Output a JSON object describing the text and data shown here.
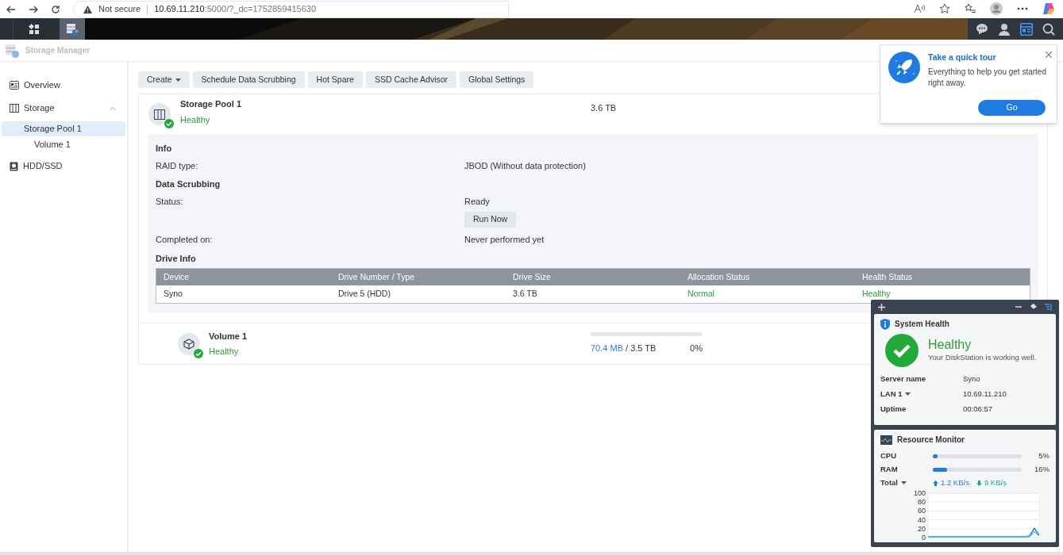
{
  "browser": {
    "warning": "Not secure",
    "url_host": "10.69.11.210",
    "url_path": ":5000/?_dc=1752859415630"
  },
  "app": {
    "title": "Storage Manager"
  },
  "sidebar": {
    "items": [
      {
        "label": "Overview",
        "selected": false
      },
      {
        "label": "Storage",
        "selected": false,
        "expanded": true,
        "children": [
          {
            "label": "Storage Pool 1",
            "selected": true,
            "children": [
              {
                "label": "Volume 1",
                "selected": false
              }
            ]
          }
        ]
      },
      {
        "label": "HDD/SSD",
        "selected": false
      }
    ]
  },
  "toolbar": [
    {
      "label": "Create",
      "kind": "dropdown"
    },
    {
      "label": "Schedule Data Scrubbing",
      "kind": "button"
    },
    {
      "label": "Hot Spare",
      "kind": "button"
    },
    {
      "label": "SSD Cache Advisor",
      "kind": "button"
    },
    {
      "label": "Global Settings",
      "kind": "button"
    }
  ],
  "pool": {
    "name": "Storage Pool 1",
    "status": "Healthy",
    "size": "3.6 TB",
    "sections": [
      {
        "heading": "Info",
        "rows": [
          {
            "label": "RAID type:",
            "value": "JBOD (Without data protection)"
          }
        ]
      },
      {
        "heading": "Data Scrubbing",
        "rows": [
          {
            "label": "Status:",
            "value": "Ready",
            "button": "Run Now"
          },
          {
            "label": "Completed on:",
            "value": "Never performed yet"
          }
        ]
      }
    ],
    "drive_info": {
      "heading": "Drive Info",
      "columns": [
        "Device",
        "Drive Number / Type",
        "Drive Size",
        "Allocation Status",
        "Health Status"
      ],
      "rows": [
        [
          {
            "text": "Syno",
            "kind": "text"
          },
          {
            "text": "Drive 5 (HDD)",
            "kind": "text"
          },
          {
            "text": "3.6 TB",
            "kind": "text"
          },
          {
            "text": "Normal",
            "kind": "status"
          },
          {
            "text": "Healthy",
            "kind": "status"
          }
        ]
      ]
    }
  },
  "volume": {
    "name": "Volume 1",
    "status": "Healthy",
    "used": "70.4 MB",
    "total": "/ 3.5 TB",
    "level": 0,
    "percent": "0%"
  },
  "tour": {
    "title": "Take a quick tour",
    "text": "Everything to help you get started right away.",
    "button": "Go"
  },
  "widgets": {
    "system_health": {
      "title": "System Health",
      "status": "Healthy",
      "message": "Your DiskStation is working well.",
      "rows": [
        {
          "label": "Server name",
          "value": "Syno",
          "has_menu": false
        },
        {
          "label": "LAN 1",
          "value": "10.69.11.210",
          "has_menu": true
        },
        {
          "label": "Uptime",
          "value": "00:06:57",
          "has_menu": false
        }
      ]
    },
    "resource_monitor": {
      "title": "Resource Monitor",
      "meters": [
        {
          "label": "CPU",
          "level": 0.05,
          "reading": "5%"
        },
        {
          "label": "RAM",
          "level": 0.16,
          "reading": "16%"
        }
      ],
      "total_label": "Total",
      "upload": "1.2 KB/s",
      "download": "9 KB/s",
      "chart_data": {
        "type": "line",
        "grid": true,
        "ylim": [
          0,
          100
        ],
        "yticks": [
          0,
          20,
          40,
          60,
          80,
          100
        ],
        "series": [
          {
            "color": "#1d6fd0",
            "values": [
              0,
              0,
              0,
              0,
              0,
              0,
              0,
              0,
              0,
              0,
              0,
              0,
              0,
              0,
              0,
              0,
              0,
              0,
              0,
              0,
              0,
              2,
              20,
              4
            ]
          },
          {
            "color": "#5fb3f0",
            "values": [
              0,
              0,
              0,
              0,
              0,
              0,
              0,
              0,
              0,
              0,
              0,
              0,
              0,
              0,
              0,
              0,
              0,
              0,
              0,
              0,
              0,
              0,
              12,
              2
            ]
          }
        ]
      }
    }
  }
}
